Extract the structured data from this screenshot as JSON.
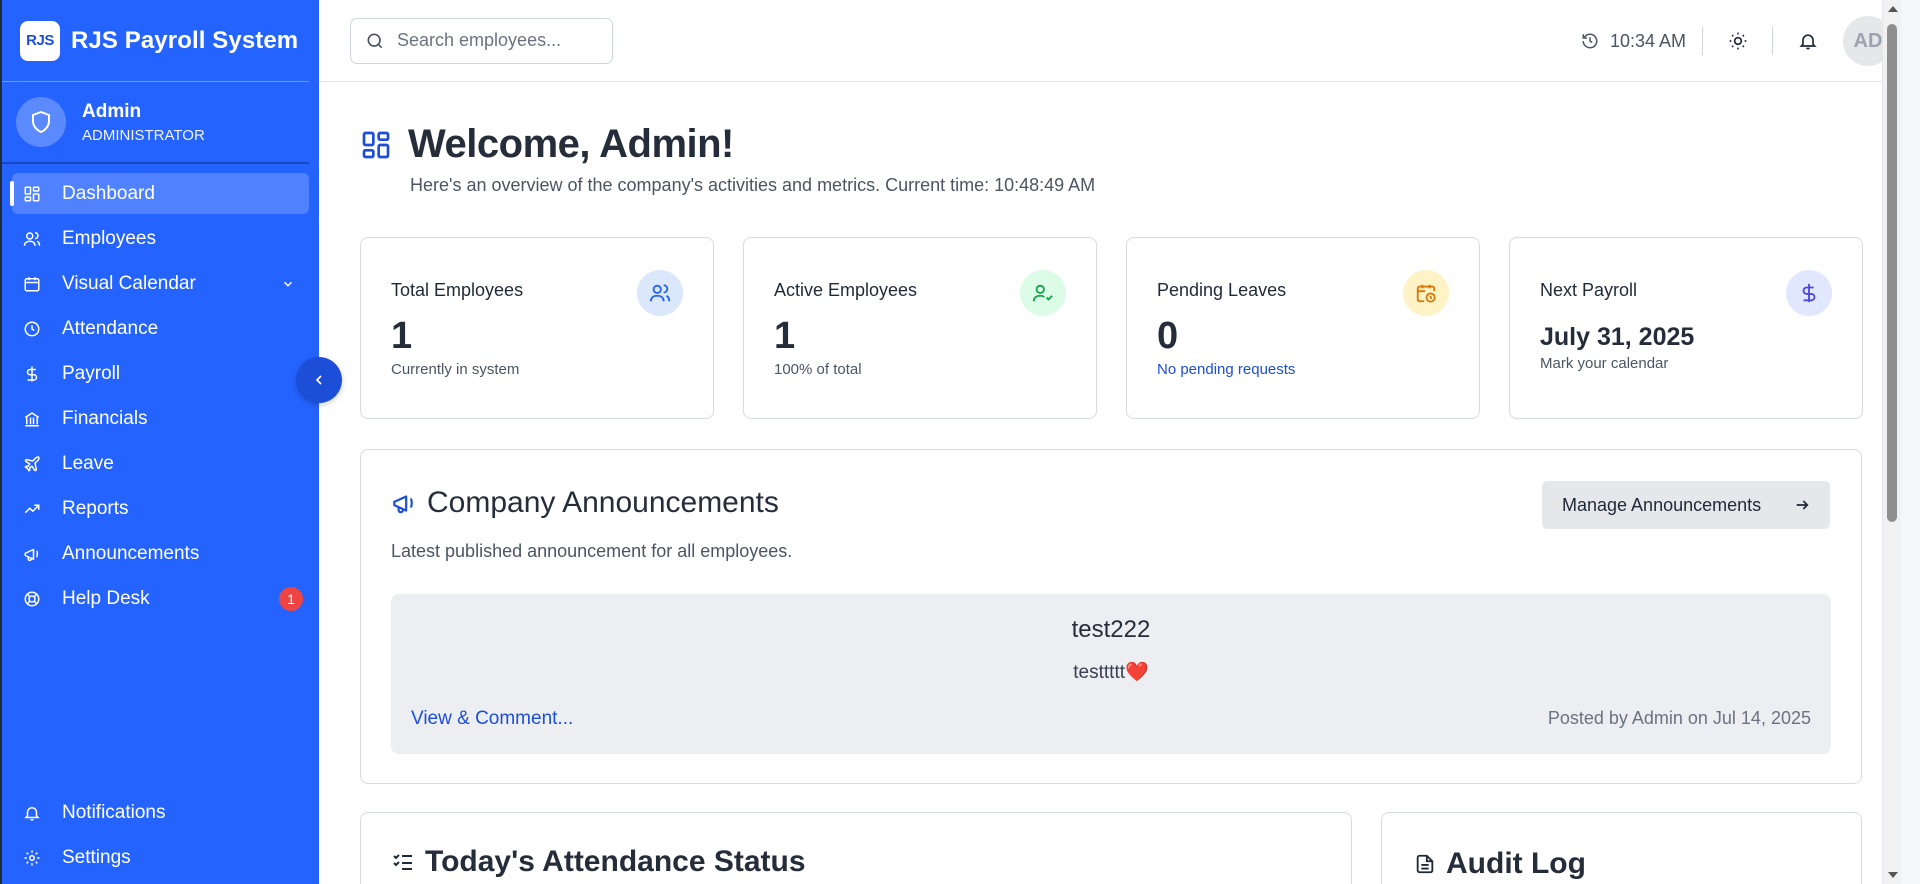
{
  "brand": {
    "logo": "RJS",
    "name": "RJS Payroll System"
  },
  "user": {
    "name": "Admin",
    "role": "ADMINISTRATOR"
  },
  "sidebar": {
    "items": [
      {
        "label": "Dashboard",
        "icon": "dashboard-icon"
      },
      {
        "label": "Employees",
        "icon": "users-icon"
      },
      {
        "label": "Visual Calendar",
        "icon": "calendar-icon"
      },
      {
        "label": "Attendance",
        "icon": "clock-icon"
      },
      {
        "label": "Payroll",
        "icon": "dollar-icon"
      },
      {
        "label": "Financials",
        "icon": "bank-icon"
      },
      {
        "label": "Leave",
        "icon": "plane-icon"
      },
      {
        "label": "Reports",
        "icon": "trend-icon"
      },
      {
        "label": "Announcements",
        "icon": "megaphone-icon"
      },
      {
        "label": "Help Desk",
        "icon": "lifebuoy-icon",
        "badge": "1"
      }
    ],
    "bottom": [
      {
        "label": "Notifications",
        "icon": "bell-icon"
      },
      {
        "label": "Settings",
        "icon": "gear-icon"
      }
    ]
  },
  "topbar": {
    "search_placeholder": "Search employees...",
    "time": "10:34 AM",
    "avatar": "AD"
  },
  "welcome": {
    "title": "Welcome, Admin!",
    "subtitle": "Here's an overview of the company's activities and metrics. Current time: 10:48:49 AM"
  },
  "cards": [
    {
      "title": "Total Employees",
      "value": "1",
      "sub": "Currently in system",
      "icon": "users-icon",
      "icon_bg": "#dbe7fb",
      "icon_color": "#2563eb"
    },
    {
      "title": "Active Employees",
      "value": "1",
      "sub": "100% of total",
      "icon": "user-check-icon",
      "icon_bg": "#dcfce7",
      "icon_color": "#16a34a"
    },
    {
      "title": "Pending Leaves",
      "value": "0",
      "sub": "No pending requests",
      "icon": "calendar-clock-icon",
      "icon_bg": "#fef3c7",
      "icon_color": "#d97706"
    },
    {
      "title": "Next Payroll",
      "value": "July 31, 2025",
      "sub": "Mark your calendar",
      "icon": "dollar-icon",
      "icon_bg": "#e0e7ff",
      "icon_color": "#4f46e5"
    }
  ],
  "announcements": {
    "title": "Company Announcements",
    "subtitle": "Latest published announcement for all employees.",
    "manage_label": "Manage Announcements",
    "item": {
      "title": "test222",
      "body": "testtttt",
      "emoji": "❤️",
      "link": "View & Comment...",
      "meta": "Posted by Admin on Jul 14, 2025"
    }
  },
  "attendance": {
    "title": "Today's Attendance Status"
  },
  "audit": {
    "title": "Audit Log"
  },
  "colors": {
    "sidebar": "#2563ff",
    "accent": "#1d4ed8",
    "badge": "#ef4444"
  }
}
